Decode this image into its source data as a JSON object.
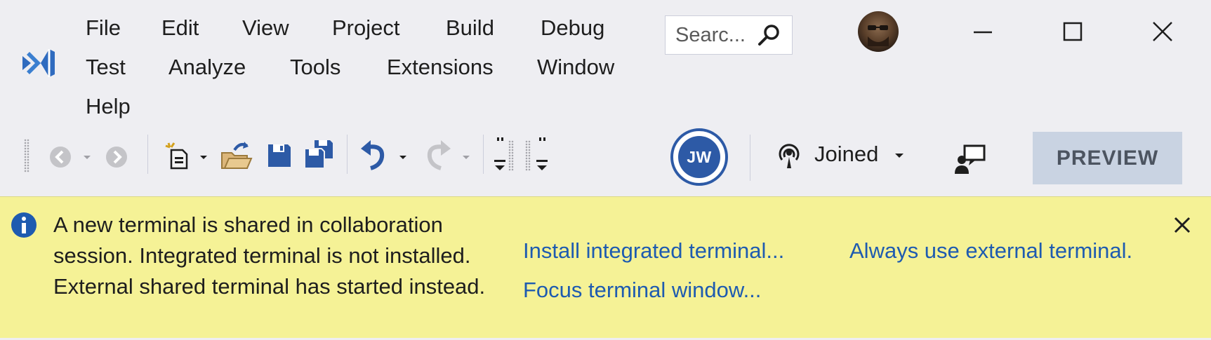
{
  "menu": {
    "items": [
      "File",
      "Edit",
      "View",
      "Project",
      "Build",
      "Debug",
      "Test",
      "Analyze",
      "Tools",
      "Extensions",
      "Window",
      "Help"
    ]
  },
  "search": {
    "placeholder": "Searc..."
  },
  "toolbar": {
    "user_initials": "JW",
    "session_status": "Joined",
    "preview_label": "PREVIEW"
  },
  "infobar": {
    "message": "A new terminal is shared in collaboration session. Integrated terminal is not installed. External shared terminal has started instead.",
    "links": {
      "install": "Install integrated terminal...",
      "always_external": "Always use external terminal.",
      "focus": "Focus terminal window..."
    }
  },
  "colors": {
    "window_bg": "#eeeef2",
    "infobar_bg": "#f5f296",
    "link": "#1e5bb0",
    "accent": "#2d5aa6",
    "vs_purple": "#68217a"
  },
  "icons": [
    "visual-studio-logo",
    "search-icon",
    "minimize-icon",
    "maximize-icon",
    "close-icon",
    "navigate-back-icon",
    "navigate-forward-icon",
    "new-project-icon",
    "open-file-icon",
    "save-icon",
    "save-all-icon",
    "undo-icon",
    "redo-icon",
    "live-share-icon",
    "feedback-icon",
    "info-icon"
  ]
}
